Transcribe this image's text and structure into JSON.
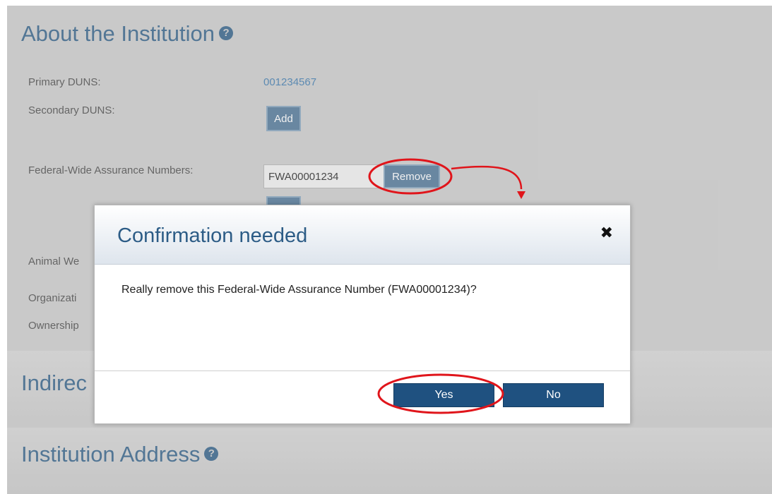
{
  "institution": {
    "title": "About the Institution",
    "help_icon": "question-circle-icon",
    "fields": {
      "primary_duns_label": "Primary DUNS:",
      "primary_duns_value": "001234567",
      "secondary_duns_label": "Secondary DUNS:",
      "add_button_label": "Add",
      "fwa_label": "Federal-Wide Assurance Numbers:",
      "fwa_value": "FWA00001234",
      "remove_button_label": "Remove",
      "animal_welfare_partial": "Animal We",
      "organization_partial": "Organizati",
      "ownership_partial": "Ownership"
    }
  },
  "indirect_section": {
    "title_partial": "Indirec"
  },
  "address_section": {
    "title": "Institution Address",
    "help_icon": "question-circle-icon"
  },
  "dialog": {
    "title": "Confirmation needed",
    "close_icon": "close-icon",
    "message": "Really remove this Federal-Wide Assurance Number (FWA00001234)?",
    "yes_label": "Yes",
    "no_label": "No"
  },
  "colors": {
    "heading": "#3e6a8f",
    "primary_button": "#1f5180",
    "annotation": "#e0151b"
  }
}
